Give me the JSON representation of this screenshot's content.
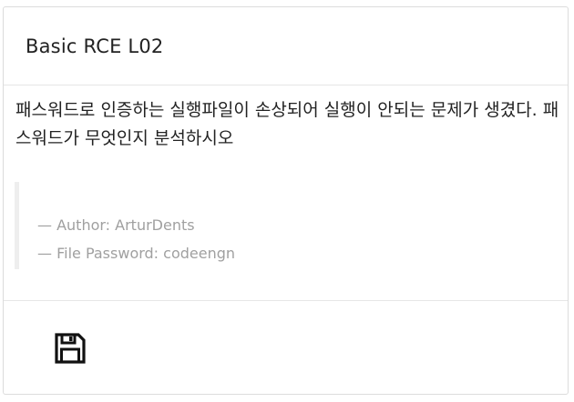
{
  "challenge": {
    "title": "Basic RCE L02",
    "description": "패스워드로 인증하는 실행파일이 손상되어 실행이 안되는 문제가 생겼다. 패스워드가 무엇인지 분석하시오",
    "author_line": "— Author: ArturDents",
    "password_line": "— File Password: codeengn"
  },
  "footer": {
    "download_icon": "floppy-disk-save-icon"
  }
}
